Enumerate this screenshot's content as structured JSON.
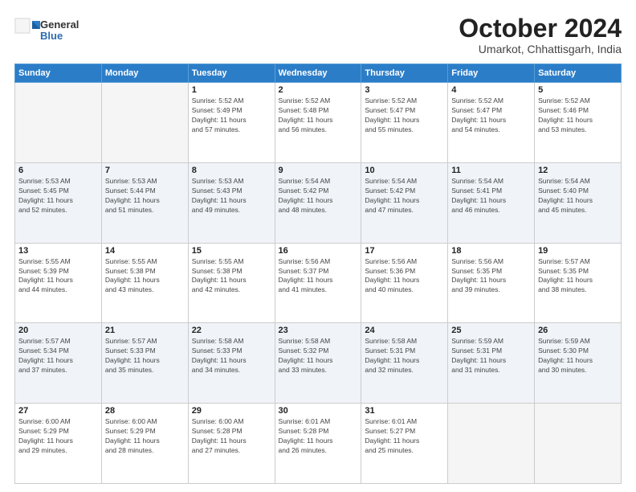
{
  "header": {
    "logo_general": "General",
    "logo_blue": "Blue",
    "title": "October 2024",
    "location": "Umarkot, Chhattisgarh, India"
  },
  "weekdays": [
    "Sunday",
    "Monday",
    "Tuesday",
    "Wednesday",
    "Thursday",
    "Friday",
    "Saturday"
  ],
  "weeks": [
    [
      {
        "day": "",
        "info": ""
      },
      {
        "day": "",
        "info": ""
      },
      {
        "day": "1",
        "info": "Sunrise: 5:52 AM\nSunset: 5:49 PM\nDaylight: 11 hours\nand 57 minutes."
      },
      {
        "day": "2",
        "info": "Sunrise: 5:52 AM\nSunset: 5:48 PM\nDaylight: 11 hours\nand 56 minutes."
      },
      {
        "day": "3",
        "info": "Sunrise: 5:52 AM\nSunset: 5:47 PM\nDaylight: 11 hours\nand 55 minutes."
      },
      {
        "day": "4",
        "info": "Sunrise: 5:52 AM\nSunset: 5:47 PM\nDaylight: 11 hours\nand 54 minutes."
      },
      {
        "day": "5",
        "info": "Sunrise: 5:52 AM\nSunset: 5:46 PM\nDaylight: 11 hours\nand 53 minutes."
      }
    ],
    [
      {
        "day": "6",
        "info": "Sunrise: 5:53 AM\nSunset: 5:45 PM\nDaylight: 11 hours\nand 52 minutes."
      },
      {
        "day": "7",
        "info": "Sunrise: 5:53 AM\nSunset: 5:44 PM\nDaylight: 11 hours\nand 51 minutes."
      },
      {
        "day": "8",
        "info": "Sunrise: 5:53 AM\nSunset: 5:43 PM\nDaylight: 11 hours\nand 49 minutes."
      },
      {
        "day": "9",
        "info": "Sunrise: 5:54 AM\nSunset: 5:42 PM\nDaylight: 11 hours\nand 48 minutes."
      },
      {
        "day": "10",
        "info": "Sunrise: 5:54 AM\nSunset: 5:42 PM\nDaylight: 11 hours\nand 47 minutes."
      },
      {
        "day": "11",
        "info": "Sunrise: 5:54 AM\nSunset: 5:41 PM\nDaylight: 11 hours\nand 46 minutes."
      },
      {
        "day": "12",
        "info": "Sunrise: 5:54 AM\nSunset: 5:40 PM\nDaylight: 11 hours\nand 45 minutes."
      }
    ],
    [
      {
        "day": "13",
        "info": "Sunrise: 5:55 AM\nSunset: 5:39 PM\nDaylight: 11 hours\nand 44 minutes."
      },
      {
        "day": "14",
        "info": "Sunrise: 5:55 AM\nSunset: 5:38 PM\nDaylight: 11 hours\nand 43 minutes."
      },
      {
        "day": "15",
        "info": "Sunrise: 5:55 AM\nSunset: 5:38 PM\nDaylight: 11 hours\nand 42 minutes."
      },
      {
        "day": "16",
        "info": "Sunrise: 5:56 AM\nSunset: 5:37 PM\nDaylight: 11 hours\nand 41 minutes."
      },
      {
        "day": "17",
        "info": "Sunrise: 5:56 AM\nSunset: 5:36 PM\nDaylight: 11 hours\nand 40 minutes."
      },
      {
        "day": "18",
        "info": "Sunrise: 5:56 AM\nSunset: 5:35 PM\nDaylight: 11 hours\nand 39 minutes."
      },
      {
        "day": "19",
        "info": "Sunrise: 5:57 AM\nSunset: 5:35 PM\nDaylight: 11 hours\nand 38 minutes."
      }
    ],
    [
      {
        "day": "20",
        "info": "Sunrise: 5:57 AM\nSunset: 5:34 PM\nDaylight: 11 hours\nand 37 minutes."
      },
      {
        "day": "21",
        "info": "Sunrise: 5:57 AM\nSunset: 5:33 PM\nDaylight: 11 hours\nand 35 minutes."
      },
      {
        "day": "22",
        "info": "Sunrise: 5:58 AM\nSunset: 5:33 PM\nDaylight: 11 hours\nand 34 minutes."
      },
      {
        "day": "23",
        "info": "Sunrise: 5:58 AM\nSunset: 5:32 PM\nDaylight: 11 hours\nand 33 minutes."
      },
      {
        "day": "24",
        "info": "Sunrise: 5:58 AM\nSunset: 5:31 PM\nDaylight: 11 hours\nand 32 minutes."
      },
      {
        "day": "25",
        "info": "Sunrise: 5:59 AM\nSunset: 5:31 PM\nDaylight: 11 hours\nand 31 minutes."
      },
      {
        "day": "26",
        "info": "Sunrise: 5:59 AM\nSunset: 5:30 PM\nDaylight: 11 hours\nand 30 minutes."
      }
    ],
    [
      {
        "day": "27",
        "info": "Sunrise: 6:00 AM\nSunset: 5:29 PM\nDaylight: 11 hours\nand 29 minutes."
      },
      {
        "day": "28",
        "info": "Sunrise: 6:00 AM\nSunset: 5:29 PM\nDaylight: 11 hours\nand 28 minutes."
      },
      {
        "day": "29",
        "info": "Sunrise: 6:00 AM\nSunset: 5:28 PM\nDaylight: 11 hours\nand 27 minutes."
      },
      {
        "day": "30",
        "info": "Sunrise: 6:01 AM\nSunset: 5:28 PM\nDaylight: 11 hours\nand 26 minutes."
      },
      {
        "day": "31",
        "info": "Sunrise: 6:01 AM\nSunset: 5:27 PM\nDaylight: 11 hours\nand 25 minutes."
      },
      {
        "day": "",
        "info": ""
      },
      {
        "day": "",
        "info": ""
      }
    ]
  ]
}
